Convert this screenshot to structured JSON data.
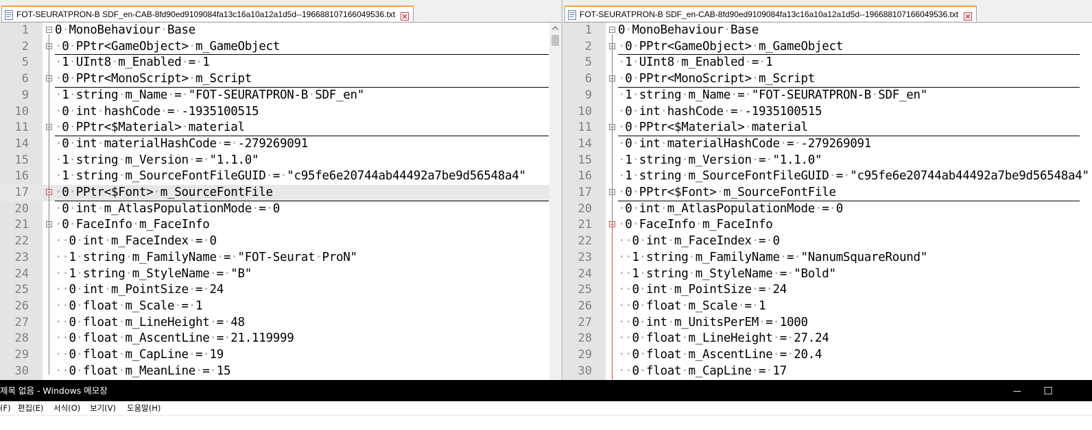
{
  "left": {
    "tab_title": "FOT-SEURATPRON-B SDF_en-CAB-8fd90ed9109084fa13c16a10a12a1d5d--196688107166049536.txt",
    "lines": [
      {
        "n": "1",
        "text": "0 MonoBehaviour Base"
      },
      {
        "n": "2",
        "text": " 0 PPtr<GameObject> m_GameObject"
      },
      {
        "n": "5",
        "text": " 1 UInt8 m_Enabled = 1"
      },
      {
        "n": "6",
        "text": " 0 PPtr<MonoScript> m_Script"
      },
      {
        "n": "9",
        "text": " 1 string m_Name = \"FOT-SEURATPRON-B SDF_en\""
      },
      {
        "n": "10",
        "text": " 0 int hashCode = -1935100515"
      },
      {
        "n": "11",
        "text": " 0 PPtr<$Material> material"
      },
      {
        "n": "14",
        "text": " 0 int materialHashCode = -279269091"
      },
      {
        "n": "15",
        "text": " 1 string m_Version = \"1.1.0\""
      },
      {
        "n": "16",
        "text": " 1 string m_SourceFontFileGUID = \"c95fe6e20744ab44492a7be9d56548a4\""
      },
      {
        "n": "17",
        "text": " 0 PPtr<$Font> m_SourceFontFile"
      },
      {
        "n": "20",
        "text": " 0 int m_AtlasPopulationMode = 0"
      },
      {
        "n": "21",
        "text": " 0 FaceInfo m_FaceInfo"
      },
      {
        "n": "22",
        "text": "  0 int m_FaceIndex = 0"
      },
      {
        "n": "23",
        "text": "  1 string m_FamilyName = \"FOT-Seurat ProN\""
      },
      {
        "n": "24",
        "text": "  1 string m_StyleName = \"B\""
      },
      {
        "n": "25",
        "text": "  0 int m_PointSize = 24"
      },
      {
        "n": "26",
        "text": "  0 float m_Scale = 1"
      },
      {
        "n": "27",
        "text": "  0 float m_LineHeight = 48"
      },
      {
        "n": "28",
        "text": "  0 float m_AscentLine = 21.119999"
      },
      {
        "n": "29",
        "text": "  0 float m_CapLine = 19"
      },
      {
        "n": "30",
        "text": "  0 float m_MeanLine = 15"
      }
    ]
  },
  "right": {
    "tab_title": "FOT-SEURATPRON-B SDF_en-CAB-8fd90ed9109084fa13c16a10a12a1d5d--196688107166049536.txt",
    "lines": [
      {
        "n": "1",
        "text": "0 MonoBehaviour Base"
      },
      {
        "n": "2",
        "text": " 0 PPtr<GameObject> m_GameObject"
      },
      {
        "n": "5",
        "text": " 1 UInt8 m_Enabled = 1"
      },
      {
        "n": "6",
        "text": " 0 PPtr<MonoScript> m_Script"
      },
      {
        "n": "9",
        "text": " 1 string m_Name = \"FOT-SEURATPRON-B SDF_en\""
      },
      {
        "n": "10",
        "text": " 0 int hashCode = -1935100515"
      },
      {
        "n": "11",
        "text": " 0 PPtr<$Material> material"
      },
      {
        "n": "14",
        "text": " 0 int materialHashCode = -279269091"
      },
      {
        "n": "15",
        "text": " 1 string m_Version = \"1.1.0\""
      },
      {
        "n": "16",
        "text": " 1 string m_SourceFontFileGUID = \"c95fe6e20744ab44492a7be9d56548a4\""
      },
      {
        "n": "17",
        "text": " 0 PPtr<$Font> m_SourceFontFile"
      },
      {
        "n": "20",
        "text": " 0 int m_AtlasPopulationMode = 0"
      },
      {
        "n": "21",
        "text": " 0 FaceInfo m_FaceInfo"
      },
      {
        "n": "22",
        "text": "  0 int m_FaceIndex = 0"
      },
      {
        "n": "23",
        "text": "  1 string m_FamilyName = \"NanumSquareRound\""
      },
      {
        "n": "24",
        "text": "  1 string m_StyleName = \"Bold\""
      },
      {
        "n": "25",
        "text": "  0 int m_PointSize = 24"
      },
      {
        "n": "26",
        "text": "  0 float m_Scale = 1"
      },
      {
        "n": "27",
        "text": "  0 int m_UnitsPerEM = 1000"
      },
      {
        "n": "28",
        "text": "  0 float m_LineHeight = 27.24"
      },
      {
        "n": "29",
        "text": "  0 float m_AscentLine = 20.4"
      },
      {
        "n": "30",
        "text": "  0 float m_CapLine = 17"
      }
    ]
  },
  "notepad": {
    "title": "제목 없음 - Windows 메모장",
    "menu": [
      "(F)",
      "편집(E)",
      "서식(O)",
      "보기(V)",
      "도움말(H)"
    ],
    "minimize_glyph": "—",
    "maximize_glyph": "☐"
  }
}
